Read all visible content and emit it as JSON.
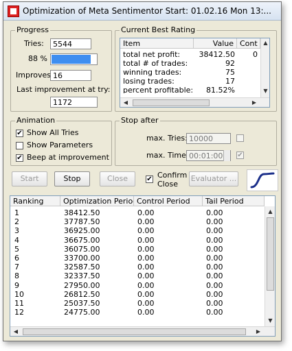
{
  "window": {
    "title": "Optimization of Meta Sentimentor Start: 01.02.16 Mon  13:..."
  },
  "progress": {
    "group_label": "Progress",
    "tries_label": "Tries:",
    "tries_value": "5544",
    "percent_label": "88 %",
    "percent_value": 0.88,
    "improves_label": "Improves:",
    "improves_value": "16",
    "last_improvement_label": "Last improvement at try:",
    "last_improvement_value": "1172"
  },
  "best_rating": {
    "group_label": "Current Best Rating",
    "columns": [
      "Item",
      "Value",
      "Cont"
    ],
    "rows": [
      {
        "item": "total net profit:",
        "value": "38412.50",
        "cont": "0"
      },
      {
        "item": "total # of trades:",
        "value": "92",
        "cont": ""
      },
      {
        "item": "winning trades:",
        "value": "75",
        "cont": ""
      },
      {
        "item": "losing trades:",
        "value": "17",
        "cont": ""
      },
      {
        "item": "percent profitable:",
        "value": "81.52%",
        "cont": ""
      }
    ]
  },
  "animation": {
    "group_label": "Animation",
    "show_all_tries": {
      "label": "Show All Tries",
      "checked": "✔"
    },
    "show_parameters": {
      "label": "Show Parameters",
      "checked": ""
    },
    "beep": {
      "label": "Beep at improvement",
      "checked": "✔"
    }
  },
  "stop_after": {
    "group_label": "Stop after",
    "max_tries_label": "max. Tries:",
    "max_tries_value": "10000",
    "max_tries_checked": "",
    "max_time_label": "max. Time:",
    "max_time_value": "00:01:00",
    "max_time_checked": "✔"
  },
  "buttons": {
    "start": "Start",
    "stop": "Stop",
    "close": "Close",
    "confirm_close_line1": "Confirm",
    "confirm_close_line2": "Close",
    "confirm_close_checked": "✔",
    "evaluator": "Evaluator ..."
  },
  "results": {
    "columns": [
      "Ranking",
      "Optimization Period",
      "Control Period",
      "Tail Period"
    ],
    "rows": [
      [
        "1",
        "38412.50",
        "0.00",
        "0.00"
      ],
      [
        "2",
        "37787.50",
        "0.00",
        "0.00"
      ],
      [
        "3",
        "36925.00",
        "0.00",
        "0.00"
      ],
      [
        "4",
        "36675.00",
        "0.00",
        "0.00"
      ],
      [
        "5",
        "36075.00",
        "0.00",
        "0.00"
      ],
      [
        "6",
        "33700.00",
        "0.00",
        "0.00"
      ],
      [
        "7",
        "32587.50",
        "0.00",
        "0.00"
      ],
      [
        "8",
        "32337.50",
        "0.00",
        "0.00"
      ],
      [
        "9",
        "27950.00",
        "0.00",
        "0.00"
      ],
      [
        "10",
        "26812.50",
        "0.00",
        "0.00"
      ],
      [
        "11",
        "25037.50",
        "0.00",
        "0.00"
      ],
      [
        "12",
        "24775.00",
        "0.00",
        "0.00"
      ]
    ]
  },
  "icons": {
    "app": "app-icon",
    "logo": "sentimentor-logo-icon",
    "scroll_up": "▲",
    "scroll_down": "▼",
    "scroll_left": "◀",
    "scroll_right": "▶"
  },
  "colors": {
    "progress_fill": "#3e8ef0",
    "logo_curve": "#1b2f8a"
  }
}
